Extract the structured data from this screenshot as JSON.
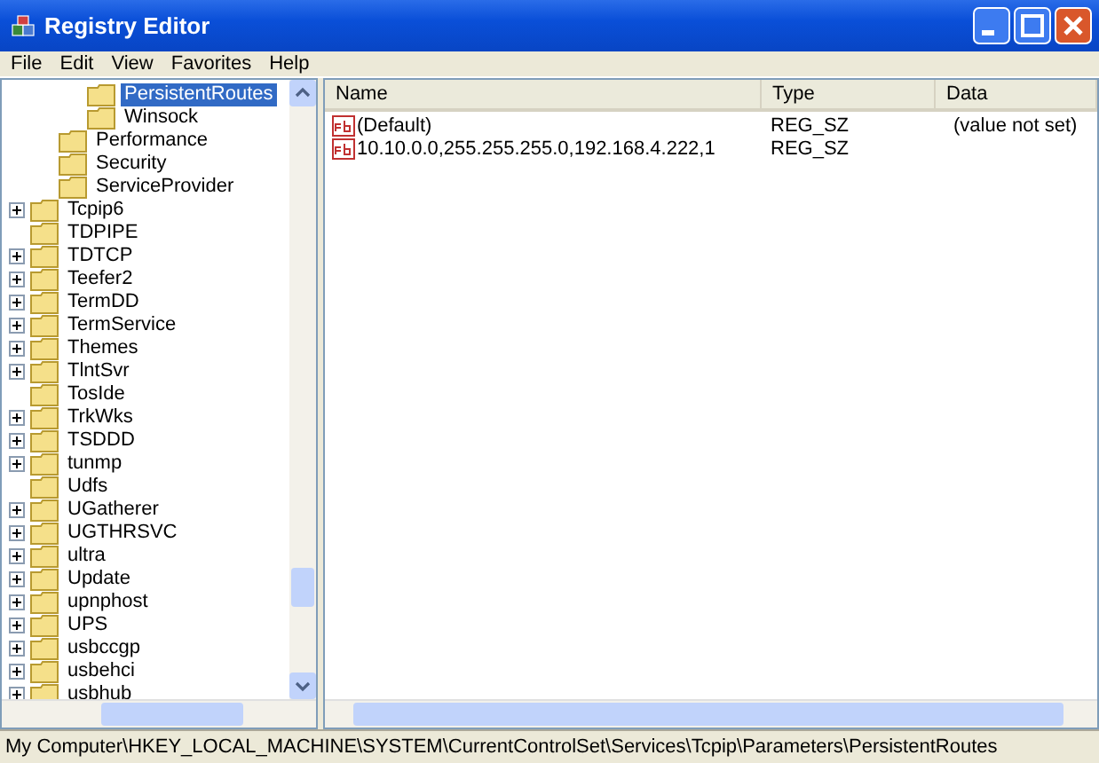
{
  "window": {
    "title": "Registry Editor"
  },
  "menu": [
    "File",
    "Edit",
    "View",
    "Favorites",
    "Help"
  ],
  "tree": {
    "items": [
      {
        "children": [
          {
            "children": [
              {
                "label": "PersistentRoutes",
                "expandable": false,
                "selected": true
              },
              {
                "label": "Winsock",
                "expandable": false,
                "selected": false
              }
            ]
          },
          {
            "label": "Performance",
            "expandable": false,
            "selected": false
          },
          {
            "label": "Security",
            "expandable": false,
            "selected": false
          },
          {
            "label": "ServiceProvider",
            "expandable": false,
            "selected": false
          }
        ]
      },
      {
        "label": "Tcpip6",
        "expandable": true,
        "selected": false
      },
      {
        "label": "TDPIPE",
        "expandable": false,
        "selected": false
      },
      {
        "label": "TDTCP",
        "expandable": true,
        "selected": false
      },
      {
        "label": "Teefer2",
        "expandable": true,
        "selected": false
      },
      {
        "label": "TermDD",
        "expandable": true,
        "selected": false
      },
      {
        "label": "TermService",
        "expandable": true,
        "selected": false
      },
      {
        "label": "Themes",
        "expandable": true,
        "selected": false
      },
      {
        "label": "TlntSvr",
        "expandable": true,
        "selected": false
      },
      {
        "label": "TosIde",
        "expandable": false,
        "selected": false
      },
      {
        "label": "TrkWks",
        "expandable": true,
        "selected": false
      },
      {
        "label": "TSDDD",
        "expandable": true,
        "selected": false
      },
      {
        "label": "tunmp",
        "expandable": true,
        "selected": false
      },
      {
        "label": "Udfs",
        "expandable": false,
        "selected": false
      },
      {
        "label": "UGatherer",
        "expandable": true,
        "selected": false
      },
      {
        "label": "UGTHRSVC",
        "expandable": true,
        "selected": false
      },
      {
        "label": "ultra",
        "expandable": true,
        "selected": false
      },
      {
        "label": "Update",
        "expandable": true,
        "selected": false
      },
      {
        "label": "upnphost",
        "expandable": true,
        "selected": false
      },
      {
        "label": "UPS",
        "expandable": true,
        "selected": false
      },
      {
        "label": "usbccgp",
        "expandable": true,
        "selected": false
      },
      {
        "label": "usbehci",
        "expandable": true,
        "selected": false
      },
      {
        "label": "usbhub",
        "expandable": true,
        "selected": false
      }
    ]
  },
  "table": {
    "columns": [
      "Name",
      "Type",
      "Data"
    ],
    "rows": [
      {
        "name": "(Default)",
        "type": "REG_SZ",
        "data": "(value not set)"
      },
      {
        "name": "10.10.0.0,255.255.255.0,192.168.4.222,1",
        "type": "REG_SZ"
      }
    ]
  },
  "status_bar": "My Computer\\HKEY_LOCAL_MACHINE\\SYSTEM\\CurrentControlSet\\Services\\Tcpip\\Parameters\\PersistentRoutes"
}
